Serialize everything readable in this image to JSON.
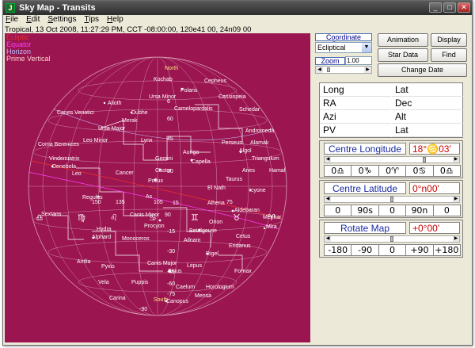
{
  "window": {
    "title": "Sky Map - Transits",
    "app_icon": "J"
  },
  "menu": [
    {
      "accel": "F",
      "rest": "ile"
    },
    {
      "accel": "E",
      "rest": "dit"
    },
    {
      "accel": "S",
      "rest": "ettings"
    },
    {
      "accel": "T",
      "rest": "ips"
    },
    {
      "accel": "H",
      "rest": "elp"
    }
  ],
  "infobar": "Tropical, 13 Oct 2008, 11:27:29 PM, CCT -08:00:00, 120e41 00, 24n09 00",
  "legend": [
    {
      "text": "Ecliptic",
      "color": "#e03030"
    },
    {
      "text": "Equator",
      "color": "#ff40ff"
    },
    {
      "text": "Horizon",
      "color": "#bfbfff"
    },
    {
      "text": "Prime Vertical",
      "color": "#ffd0d0"
    }
  ],
  "sky": {
    "background": "#9b1550",
    "zodiac_symbols": [
      "♎",
      "♍",
      "♌",
      "♋",
      "♊",
      "♉",
      "♈",
      "♓"
    ],
    "labels": {
      "north": "North",
      "south": "South",
      "kochab": "Kochab",
      "polaris": "Polaris",
      "cepheus": "Cepheus",
      "ursa_minor": "Ursa Minor",
      "cassiopeia": "Cassiopeia",
      "canes_venatici": "Canes Venatici",
      "alioth": "Alioth",
      "dubhe": "Dubhe",
      "camelopardalis": "Camelopardalis",
      "merak": "Merak",
      "schedar": "Schedar",
      "ursa_major": "Ursa Major",
      "andromeda": "Andromeda",
      "coma_berenices": "Coma Berenices",
      "leo_minor": "Leo Minor",
      "lynx": "Lynx",
      "perseus": "Perseus",
      "alamak": "Alamak",
      "auriga": "Auriga",
      "capella": "Capella",
      "algol": "Algol",
      "triangulum": "Triangulum",
      "vindemiatrix": "Vindemiatrix",
      "denebola": "Denebola",
      "leo": "Leo",
      "gemini": "Gemini",
      "cancer": "Cancer",
      "castor": "Castor",
      "pollux": "Pollux",
      "aries": "Aries",
      "hamal": "Hamal",
      "taurus": "Taurus",
      "el_nath": "El Nath",
      "regulus": "Regulus",
      "as": "As",
      "alhena": "Alhena",
      "icyone": "Icyone",
      "aldebaran": "Aldebaran",
      "sextans": "Sextans",
      "canis_minor": "Canis Minor",
      "procyon": "Procyon",
      "menkar": "Menkar",
      "mira": "Mira",
      "hydra": "Hydra",
      "betelgeuse": "Betelgeuse",
      "alphard": "Alphard",
      "cetus": "Cetus",
      "orion": "Orion",
      "monoceros": "Monoceros",
      "ailnam": "Ailnam",
      "rigel": "Rigel",
      "eridanus": "Eridanus",
      "antlia": "Antlia",
      "pyxis": "Pyxis",
      "canis_major": "Canis Major",
      "sirius": "Sirius",
      "lepus": "Lepus",
      "vela": "Vela",
      "puppis": "Puppis",
      "fornax": "Fornax",
      "horologium": "Horologium",
      "caelum": "Caelum",
      "carina": "Carina",
      "canopus": "Canopus",
      "mensa": "Mensa",
      "cetus_short": "Cet"
    },
    "grid_numbers": [
      "6",
      "15",
      "30",
      "45",
      "60",
      "75",
      "90",
      "105",
      "135",
      "150",
      "-15",
      "-30",
      "-45",
      "-60",
      "-75",
      "-90",
      "105",
      "135",
      "150"
    ]
  },
  "coord_system": {
    "title": "Coordinate System",
    "value": "Ecliptical"
  },
  "zoom": {
    "title": "Zoom",
    "value": "1.00",
    "position": 0.08
  },
  "buttons": {
    "animation": "Animation",
    "display": "Display",
    "star_data": "Star Data",
    "find": "Find",
    "change_date": "Change Date"
  },
  "coords": [
    [
      "Long",
      "Lat"
    ],
    [
      "RA",
      "Dec"
    ],
    [
      "Azi",
      "Alt"
    ],
    [
      "PV",
      "Lat"
    ]
  ],
  "centre_longitude": {
    "title": "Centre Longitude",
    "value": "18°♋03'",
    "position": 0.78,
    "buttons": [
      "0♎",
      "0♑",
      "0♈",
      "0♋",
      "0♎"
    ]
  },
  "centre_latitude": {
    "title": "Centre Latitude",
    "value": "0°n00'",
    "position": 0.5,
    "buttons": [
      "0",
      "90s",
      "0",
      "90n",
      "0"
    ]
  },
  "rotate_map": {
    "title": "Rotate Map",
    "value": "+0°00'",
    "position": 0.5,
    "buttons": [
      "-180",
      "-90",
      "0",
      "+90",
      "+180"
    ]
  }
}
